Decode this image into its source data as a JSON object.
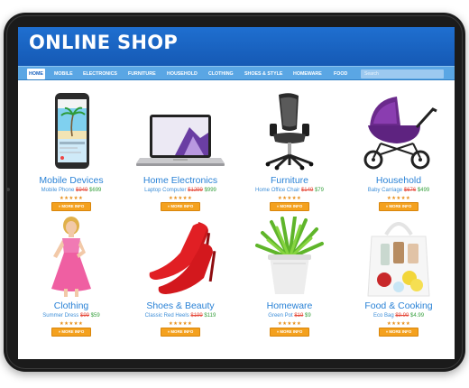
{
  "shop_title": "ONLINE SHOP",
  "nav": {
    "items": [
      "HOME",
      "MOBILE",
      "ELECTRONICS",
      "FURNITURE",
      "HOUSEHOLD",
      "CLOTHING",
      "SHOES & STYLE",
      "HOMEWARE",
      "FOOD"
    ],
    "active": "HOME"
  },
  "search": {
    "placeholder": "Search"
  },
  "products": [
    {
      "category": "Mobile Devices",
      "item": "Mobile Phone",
      "old_price": "$949",
      "price": "$699",
      "stars": "★★★★★",
      "button": "» MORE INFO"
    },
    {
      "category": "Home Electronics",
      "item": "Laptop Computer",
      "old_price": "$1299",
      "price": "$999",
      "stars": "★★★★★",
      "button": "» MORE INFO"
    },
    {
      "category": "Furniture",
      "item": "Home Office Chair",
      "old_price": "$149",
      "price": "$79",
      "stars": "★★★★★",
      "button": "» MORE INFO"
    },
    {
      "category": "Household",
      "item": "Baby Carriage",
      "old_price": "$676",
      "price": "$499",
      "stars": "★★★★★",
      "button": "» MORE INFO"
    },
    {
      "category": "Clothing",
      "item": "Summer Dress",
      "old_price": "$99",
      "price": "$59",
      "stars": "★★★★★",
      "button": "» MORE INFO"
    },
    {
      "category": "Shoes & Beauty",
      "item": "Classic Red Heels",
      "old_price": "$199",
      "price": "$119",
      "stars": "★★★★★",
      "button": "» MORE INFO"
    },
    {
      "category": "Homeware",
      "item": "Green Pot",
      "old_price": "$19",
      "price": "$9",
      "stars": "★★★★★",
      "button": "» MORE INFO"
    },
    {
      "category": "Food & Cooking",
      "item": "Eco Bag",
      "old_price": "$9.99",
      "price": "$4.99",
      "stars": "★★★★★",
      "button": "» MORE INFO"
    }
  ],
  "icons": [
    "phone-image",
    "laptop-image",
    "office-chair-image",
    "baby-carriage-image",
    "dress-model-image",
    "red-heels-image",
    "plant-pot-image",
    "eco-bag-image"
  ],
  "colors": {
    "header": "#1f6fd0",
    "nav": "#5aa6e4",
    "product_name": "#2a82d6",
    "old_price": "#e64b3c",
    "new_price": "#39a140",
    "button": "#f4a11e"
  }
}
